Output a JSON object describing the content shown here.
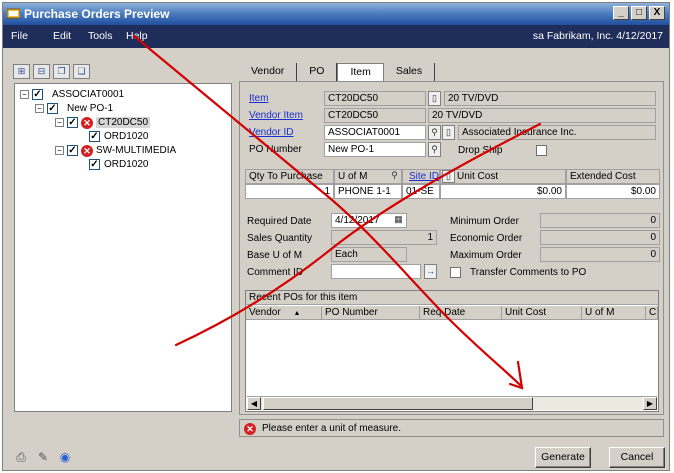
{
  "window": {
    "title": "Purchase Orders Preview",
    "controls": [
      "_",
      "□",
      "X"
    ]
  },
  "menu": {
    "items": [
      "File",
      "Edit",
      "Tools",
      "Help"
    ],
    "company": "sa  Fabrikam, Inc.  4/12/2017"
  },
  "tree": {
    "nodes": [
      {
        "label": "ASSOCIAT0001"
      },
      {
        "label": "New PO-1"
      },
      {
        "label": "CT20DC50"
      },
      {
        "label": "ORD1020"
      },
      {
        "label": "SW-MULTIMEDIA"
      },
      {
        "label": "ORD1020"
      }
    ]
  },
  "tabs": [
    "Vendor",
    "PO",
    "Item",
    "Sales"
  ],
  "item_tab": {
    "item_label": "Item",
    "item_value": "CT20DC50",
    "item_desc": "20 TV/DVD",
    "vendor_item_label": "Vendor Item",
    "vendor_item_value": "CT20DC50",
    "vendor_item_desc": "20 TV/DVD",
    "vendor_id_label": "Vendor ID",
    "vendor_id_value": "ASSOCIAT0001",
    "vendor_name": "Associated Insurance Inc.",
    "po_number_label": "PO Number",
    "po_number_value": "New PO-1",
    "drop_ship_label": "Drop Ship",
    "grid_headers": [
      "Qty To Purchase",
      "U of M",
      "Site ID",
      "Unit Cost",
      "Extended Cost"
    ],
    "grid_row": {
      "qty": "1",
      "uofm": "PHONE 1-1",
      "site": "01-SE",
      "unit_cost": "$0.00",
      "ext_cost": "$0.00"
    },
    "required_date_label": "Required Date",
    "required_date_value": "4/12/2017",
    "sales_qty_label": "Sales Quantity",
    "sales_qty_value": "1",
    "base_uofm_label": "Base U of M",
    "base_uofm_value": "Each",
    "comment_id_label": "Comment ID",
    "min_order_label": "Minimum Order",
    "min_order_value": "0",
    "econ_order_label": "Economic Order",
    "econ_order_value": "0",
    "max_order_label": "Maximum Order",
    "max_order_value": "0",
    "transfer_label": "Transfer Comments to PO"
  },
  "recent": {
    "title": "Recent POs for this item",
    "headers": [
      "Vendor",
      "PO Number",
      "Req Date",
      "Unit Cost",
      "U of M",
      "C"
    ]
  },
  "status": {
    "message": "Please enter a unit of measure."
  },
  "buttons": {
    "generate": "Generate",
    "cancel": "Cancel"
  },
  "colors": {
    "title_bar": "#1f4f9f",
    "menu_bar": "#1f2d5a",
    "link": "#1a2fd0",
    "error": "#d42020",
    "annotation": "#d40000"
  }
}
